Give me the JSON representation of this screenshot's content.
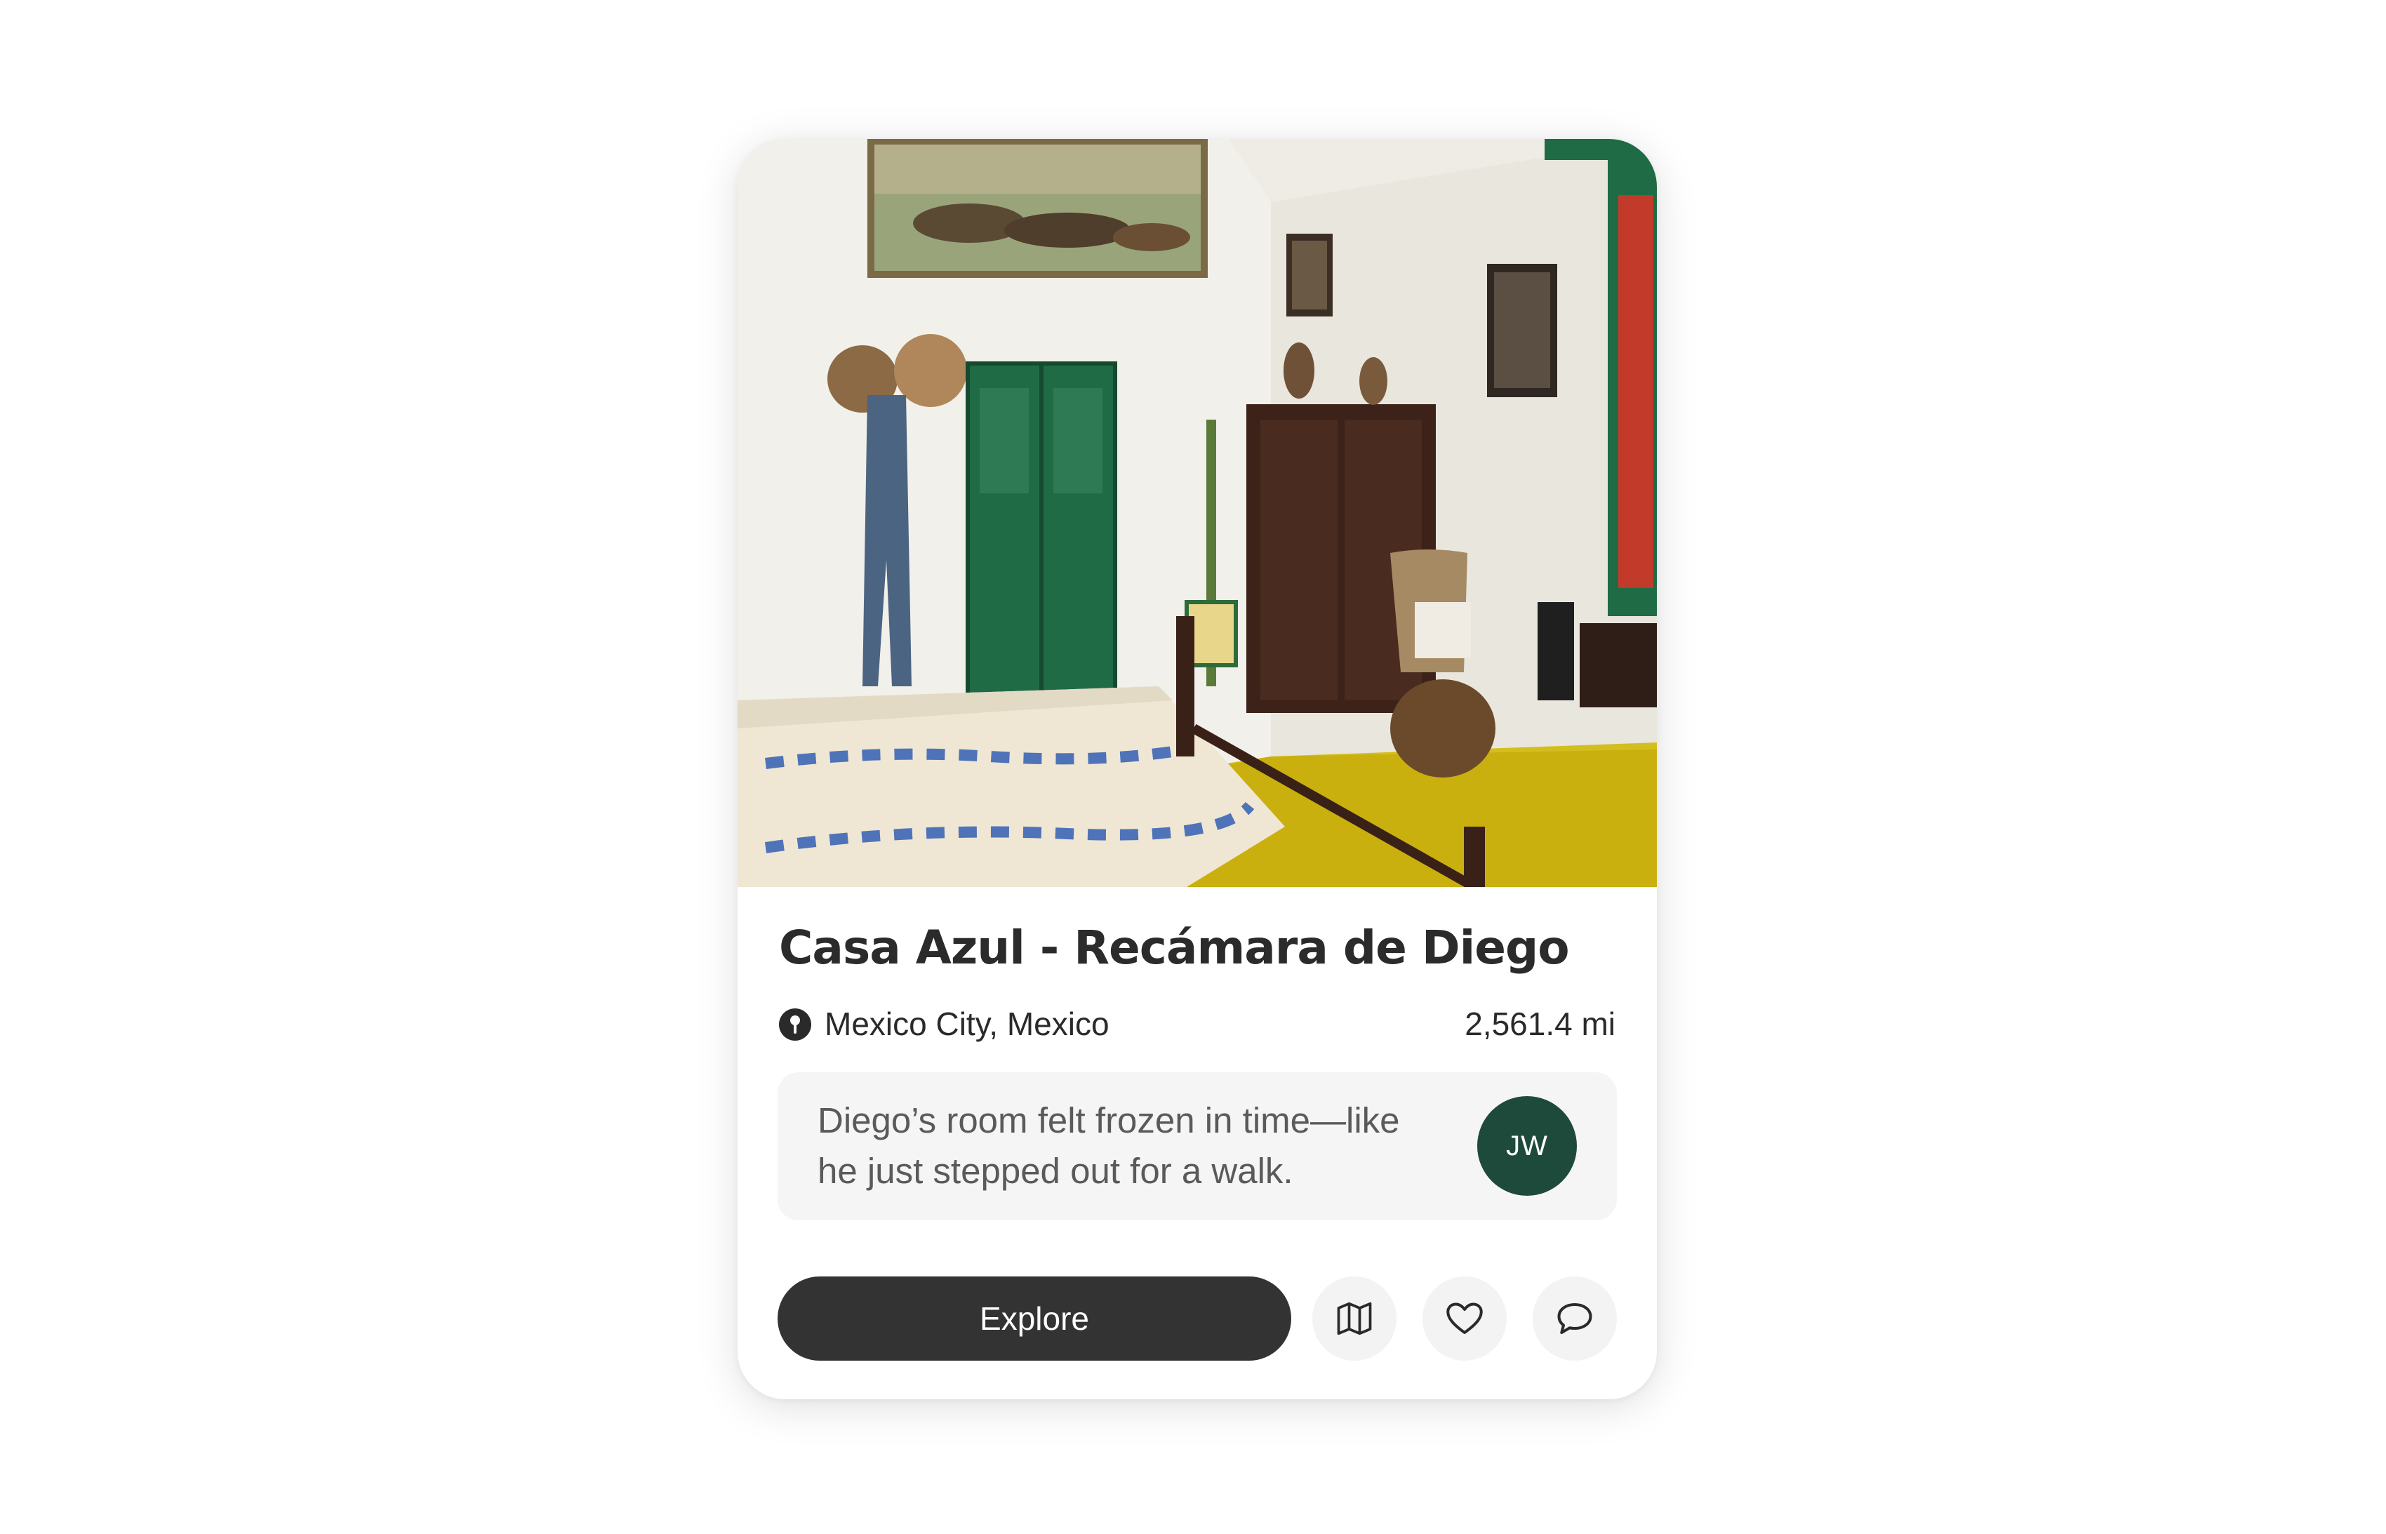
{
  "place": {
    "title": "Casa Azul - Recámara de Diego",
    "location": "Mexico City, Mexico",
    "distance": "2,561.4 mi",
    "photo_icon": "bedroom-photo"
  },
  "review": {
    "text": "Diego’s room felt frozen in time—like he just stepped out for a walk.",
    "author_initials": "JW",
    "avatar_color": "#1e4a3c"
  },
  "actions": {
    "explore_label": "Explore",
    "map_icon": "map-icon",
    "like_icon": "heart-icon",
    "comment_icon": "comment-icon"
  },
  "colors": {
    "primary_button": "#333333",
    "icon_button_bg": "#f3f3f3",
    "quote_bg": "#f5f5f5"
  }
}
